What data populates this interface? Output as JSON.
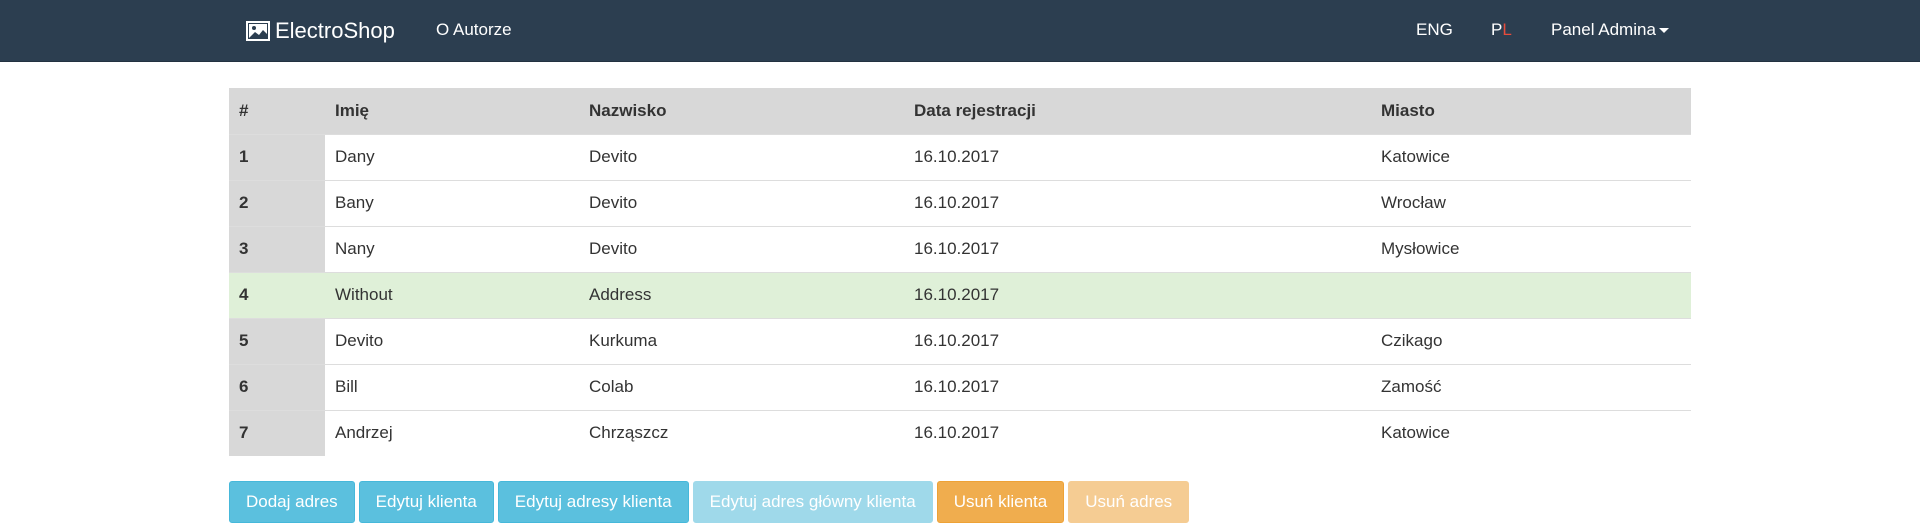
{
  "navbar": {
    "brand": "ElectroShop",
    "brand_icon": "image-icon",
    "about": "O Autorze",
    "lang_eng": "ENG",
    "lang_pl_p": "P",
    "lang_pl_l": "L",
    "admin_panel": "Panel Admina"
  },
  "table": {
    "headers": [
      "#",
      "Imię",
      "Nazwisko",
      "Data rejestracji",
      "Miasto"
    ],
    "rows": [
      {
        "idx": "1",
        "first": "Dany",
        "last": "Devito",
        "date": "16.10.2017",
        "city": "Katowice"
      },
      {
        "idx": "2",
        "first": "Bany",
        "last": "Devito",
        "date": "16.10.2017",
        "city": "Wrocław"
      },
      {
        "idx": "3",
        "first": "Nany",
        "last": "Devito",
        "date": "16.10.2017",
        "city": "Mysłowice"
      },
      {
        "idx": "4",
        "first": "Without",
        "last": "Address",
        "date": "16.10.2017",
        "city": ""
      },
      {
        "idx": "5",
        "first": "Devito",
        "last": "Kurkuma",
        "date": "16.10.2017",
        "city": "Czikago"
      },
      {
        "idx": "6",
        "first": "Bill",
        "last": "Colab",
        "date": "16.10.2017",
        "city": "Zamość"
      },
      {
        "idx": "7",
        "first": "Andrzej",
        "last": "Chrząszcz",
        "date": "16.10.2017",
        "city": "Katowice"
      }
    ],
    "selected_row": "4"
  },
  "actions": {
    "add_address": "Dodaj adres",
    "edit_client": "Edytuj klienta",
    "edit_client_addresses": "Edytuj adresy klienta",
    "edit_main_address": "Edytuj adres główny klienta",
    "delete_client": "Usuń klienta",
    "delete_address": "Usuń adres"
  },
  "colors": {
    "navbar": "#2c3e50",
    "info": "#5bc0de",
    "warning": "#f0ad4e",
    "selected_row": "#dff0d8",
    "pl_accent": "#e74c3c"
  }
}
